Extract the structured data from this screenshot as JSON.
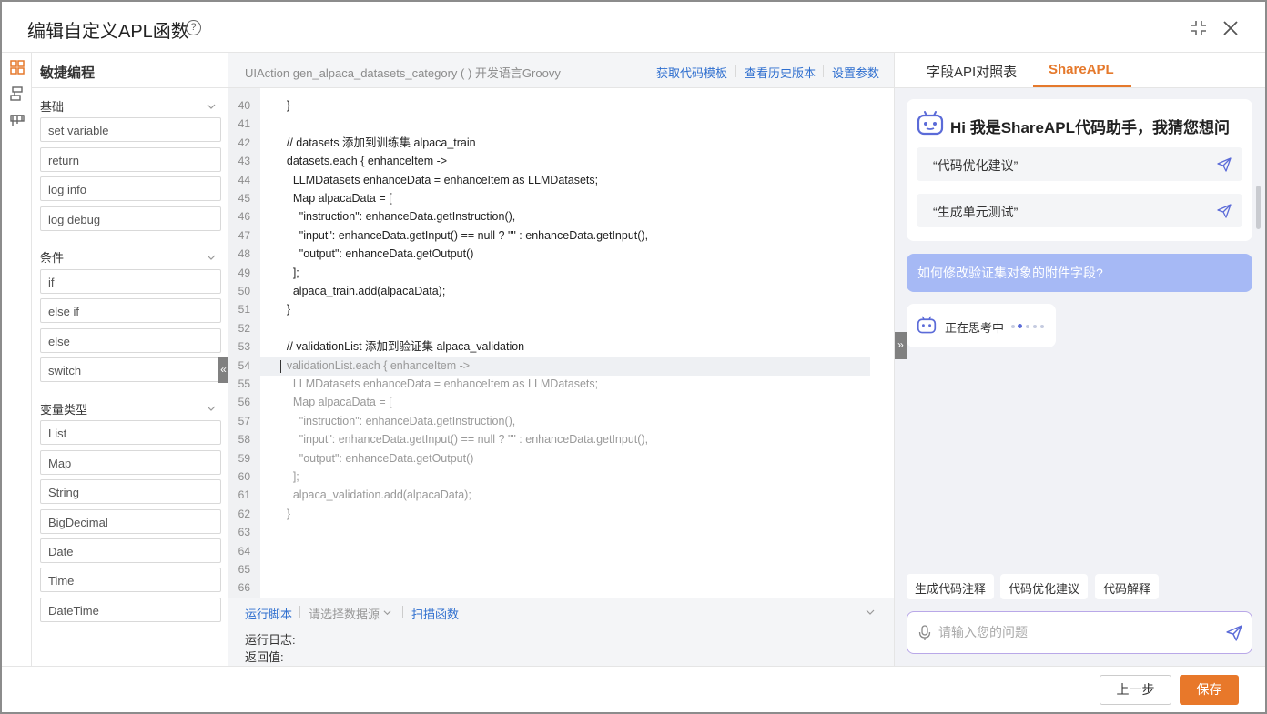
{
  "dialog": {
    "title": "编辑自定义APL函数",
    "help_icon": "?"
  },
  "left_panel": {
    "title": "敏捷编程",
    "sections": [
      {
        "title": "基础",
        "items": [
          "set variable",
          "return",
          "log info",
          "log debug"
        ]
      },
      {
        "title": "条件",
        "items": [
          "if",
          "else if",
          "else",
          "switch"
        ]
      },
      {
        "title": "变量类型",
        "items": [
          "List",
          "Map",
          "String",
          "BigDecimal",
          "Date",
          "Time",
          "DateTime"
        ]
      }
    ],
    "collapse_glyph": "«"
  },
  "editor": {
    "signature": "UIAction gen_alpaca_datasets_category ( ) 开发语言Groovy",
    "actions": [
      "获取代码模板",
      "查看历史版本",
      "设置参数"
    ],
    "lines": [
      {
        "n": "40",
        "code": "    }",
        "dim": false
      },
      {
        "n": "41",
        "code": "",
        "dim": false
      },
      {
        "n": "42",
        "code": "    // datasets 添加到训练集 alpaca_train",
        "dim": false
      },
      {
        "n": "43",
        "code": "    datasets.each { enhanceItem ->",
        "dim": false
      },
      {
        "n": "44",
        "code": "      LLMDatasets enhanceData = enhanceItem as LLMDatasets;",
        "dim": false
      },
      {
        "n": "45",
        "code": "      Map alpacaData = [",
        "dim": false
      },
      {
        "n": "46",
        "code": "        \"instruction\": enhanceData.getInstruction(),",
        "dim": false
      },
      {
        "n": "47",
        "code": "        \"input\": enhanceData.getInput() == null ? \"\" : enhanceData.getInput(),",
        "dim": false
      },
      {
        "n": "48",
        "code": "        \"output\": enhanceData.getOutput()",
        "dim": false
      },
      {
        "n": "49",
        "code": "      ];",
        "dim": false
      },
      {
        "n": "50",
        "code": "      alpaca_train.add(alpacaData);",
        "dim": false
      },
      {
        "n": "51",
        "code": "    }",
        "dim": false
      },
      {
        "n": "52",
        "code": "",
        "dim": false
      },
      {
        "n": "53",
        "code": "    // validationList 添加到验证集 alpaca_validation",
        "dim": false
      },
      {
        "n": "54",
        "code": "    validationList.each { enhanceItem ->",
        "dim": true
      },
      {
        "n": "55",
        "code": "      LLMDatasets enhanceData = enhanceItem as LLMDatasets;",
        "dim": true
      },
      {
        "n": "56",
        "code": "      Map alpacaData = [",
        "dim": true
      },
      {
        "n": "57",
        "code": "        \"instruction\": enhanceData.getInstruction(),",
        "dim": true
      },
      {
        "n": "58",
        "code": "        \"input\": enhanceData.getInput() == null ? \"\" : enhanceData.getInput(),",
        "dim": true
      },
      {
        "n": "59",
        "code": "        \"output\": enhanceData.getOutput()",
        "dim": true
      },
      {
        "n": "60",
        "code": "      ];",
        "dim": true
      },
      {
        "n": "61",
        "code": "      alpaca_validation.add(alpacaData);",
        "dim": true
      },
      {
        "n": "62",
        "code": "    }",
        "dim": true
      },
      {
        "n": "63",
        "code": "",
        "dim": false
      },
      {
        "n": "64",
        "code": "",
        "dim": false
      },
      {
        "n": "65",
        "code": "",
        "dim": false
      },
      {
        "n": "66",
        "code": "",
        "dim": false
      }
    ],
    "bottom": {
      "run_script": "运行脚本",
      "datasource_placeholder": "请选择数据源",
      "scan_function": "扫描函数",
      "run_log_label": "运行日志:",
      "return_label": "返回值:"
    }
  },
  "right_panel": {
    "tabs": [
      "字段API对照表",
      "ShareAPL"
    ],
    "active_tab": "ShareAPL",
    "expand_glyph": "»",
    "welcome_title": "Hi 我是ShareAPL代码助手，我猜您想问",
    "suggestions": [
      "“代码优化建议”",
      "“生成单元测试”"
    ],
    "user_message": "如何修改验证集对象的附件字段?",
    "thinking_text": "正在思考中",
    "chips": [
      "生成代码注释",
      "代码优化建议",
      "代码解释"
    ],
    "input_placeholder": "请输入您的问题"
  },
  "footer": {
    "prev_label": "上一步",
    "save_label": "保存"
  },
  "colors": {
    "accent": "#e8782a",
    "link": "#2f6fcf",
    "user_bubble": "#a6b9f5"
  }
}
